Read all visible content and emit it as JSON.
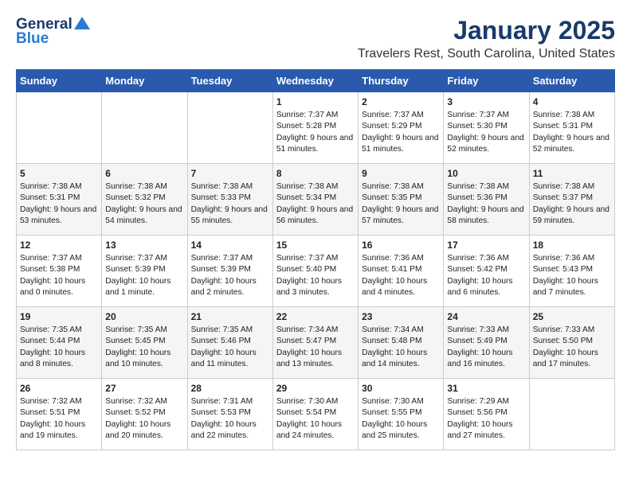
{
  "logo": {
    "general": "General",
    "blue": "Blue"
  },
  "header": {
    "title": "January 2025",
    "subtitle": "Travelers Rest, South Carolina, United States"
  },
  "weekdays": [
    "Sunday",
    "Monday",
    "Tuesday",
    "Wednesday",
    "Thursday",
    "Friday",
    "Saturday"
  ],
  "weeks": [
    [
      {
        "day": "",
        "info": ""
      },
      {
        "day": "",
        "info": ""
      },
      {
        "day": "",
        "info": ""
      },
      {
        "day": "1",
        "info": "Sunrise: 7:37 AM\nSunset: 5:28 PM\nDaylight: 9 hours and 51 minutes."
      },
      {
        "day": "2",
        "info": "Sunrise: 7:37 AM\nSunset: 5:29 PM\nDaylight: 9 hours and 51 minutes."
      },
      {
        "day": "3",
        "info": "Sunrise: 7:37 AM\nSunset: 5:30 PM\nDaylight: 9 hours and 52 minutes."
      },
      {
        "day": "4",
        "info": "Sunrise: 7:38 AM\nSunset: 5:31 PM\nDaylight: 9 hours and 52 minutes."
      }
    ],
    [
      {
        "day": "5",
        "info": "Sunrise: 7:38 AM\nSunset: 5:31 PM\nDaylight: 9 hours and 53 minutes."
      },
      {
        "day": "6",
        "info": "Sunrise: 7:38 AM\nSunset: 5:32 PM\nDaylight: 9 hours and 54 minutes."
      },
      {
        "day": "7",
        "info": "Sunrise: 7:38 AM\nSunset: 5:33 PM\nDaylight: 9 hours and 55 minutes."
      },
      {
        "day": "8",
        "info": "Sunrise: 7:38 AM\nSunset: 5:34 PM\nDaylight: 9 hours and 56 minutes."
      },
      {
        "day": "9",
        "info": "Sunrise: 7:38 AM\nSunset: 5:35 PM\nDaylight: 9 hours and 57 minutes."
      },
      {
        "day": "10",
        "info": "Sunrise: 7:38 AM\nSunset: 5:36 PM\nDaylight: 9 hours and 58 minutes."
      },
      {
        "day": "11",
        "info": "Sunrise: 7:38 AM\nSunset: 5:37 PM\nDaylight: 9 hours and 59 minutes."
      }
    ],
    [
      {
        "day": "12",
        "info": "Sunrise: 7:37 AM\nSunset: 5:38 PM\nDaylight: 10 hours and 0 minutes."
      },
      {
        "day": "13",
        "info": "Sunrise: 7:37 AM\nSunset: 5:39 PM\nDaylight: 10 hours and 1 minute."
      },
      {
        "day": "14",
        "info": "Sunrise: 7:37 AM\nSunset: 5:39 PM\nDaylight: 10 hours and 2 minutes."
      },
      {
        "day": "15",
        "info": "Sunrise: 7:37 AM\nSunset: 5:40 PM\nDaylight: 10 hours and 3 minutes."
      },
      {
        "day": "16",
        "info": "Sunrise: 7:36 AM\nSunset: 5:41 PM\nDaylight: 10 hours and 4 minutes."
      },
      {
        "day": "17",
        "info": "Sunrise: 7:36 AM\nSunset: 5:42 PM\nDaylight: 10 hours and 6 minutes."
      },
      {
        "day": "18",
        "info": "Sunrise: 7:36 AM\nSunset: 5:43 PM\nDaylight: 10 hours and 7 minutes."
      }
    ],
    [
      {
        "day": "19",
        "info": "Sunrise: 7:35 AM\nSunset: 5:44 PM\nDaylight: 10 hours and 8 minutes."
      },
      {
        "day": "20",
        "info": "Sunrise: 7:35 AM\nSunset: 5:45 PM\nDaylight: 10 hours and 10 minutes."
      },
      {
        "day": "21",
        "info": "Sunrise: 7:35 AM\nSunset: 5:46 PM\nDaylight: 10 hours and 11 minutes."
      },
      {
        "day": "22",
        "info": "Sunrise: 7:34 AM\nSunset: 5:47 PM\nDaylight: 10 hours and 13 minutes."
      },
      {
        "day": "23",
        "info": "Sunrise: 7:34 AM\nSunset: 5:48 PM\nDaylight: 10 hours and 14 minutes."
      },
      {
        "day": "24",
        "info": "Sunrise: 7:33 AM\nSunset: 5:49 PM\nDaylight: 10 hours and 16 minutes."
      },
      {
        "day": "25",
        "info": "Sunrise: 7:33 AM\nSunset: 5:50 PM\nDaylight: 10 hours and 17 minutes."
      }
    ],
    [
      {
        "day": "26",
        "info": "Sunrise: 7:32 AM\nSunset: 5:51 PM\nDaylight: 10 hours and 19 minutes."
      },
      {
        "day": "27",
        "info": "Sunrise: 7:32 AM\nSunset: 5:52 PM\nDaylight: 10 hours and 20 minutes."
      },
      {
        "day": "28",
        "info": "Sunrise: 7:31 AM\nSunset: 5:53 PM\nDaylight: 10 hours and 22 minutes."
      },
      {
        "day": "29",
        "info": "Sunrise: 7:30 AM\nSunset: 5:54 PM\nDaylight: 10 hours and 24 minutes."
      },
      {
        "day": "30",
        "info": "Sunrise: 7:30 AM\nSunset: 5:55 PM\nDaylight: 10 hours and 25 minutes."
      },
      {
        "day": "31",
        "info": "Sunrise: 7:29 AM\nSunset: 5:56 PM\nDaylight: 10 hours and 27 minutes."
      },
      {
        "day": "",
        "info": ""
      }
    ]
  ]
}
